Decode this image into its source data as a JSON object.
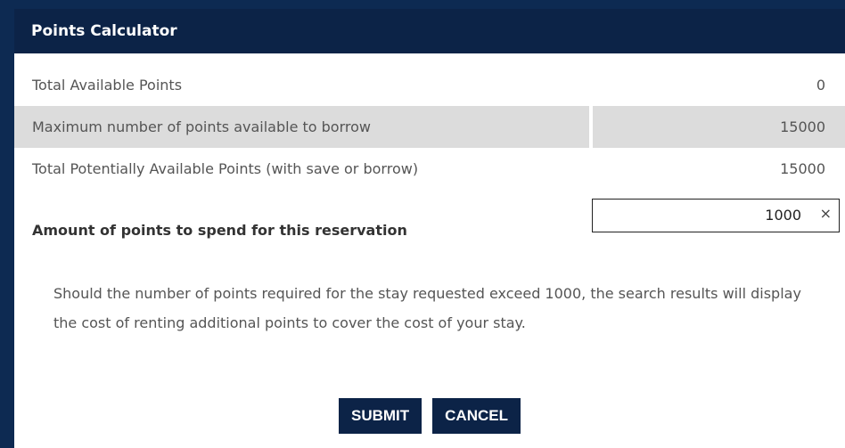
{
  "dialog": {
    "title": "Points Calculator",
    "rows": [
      {
        "label": "Total Available Points",
        "value": "0"
      },
      {
        "label": "Maximum number of points available to borrow",
        "value": "15000"
      },
      {
        "label": "Total Potentially Available Points (with save or borrow)",
        "value": "15000"
      }
    ],
    "spend": {
      "label": "Amount of points to spend for this reservation",
      "value": "1000",
      "clear_symbol": "×"
    },
    "note": "Should the number of points required for the stay requested exceed 1000, the search results will display the cost of renting additional points to cover the cost of your stay.",
    "buttons": {
      "submit": "SUBMIT",
      "cancel": "CANCEL"
    }
  },
  "colors": {
    "page_background": "#0d2a52",
    "header_background": "#0c2347",
    "button_background": "#0c2347",
    "shaded_row": "#dcdcdc"
  },
  "icons": {
    "clear": "close-icon"
  }
}
